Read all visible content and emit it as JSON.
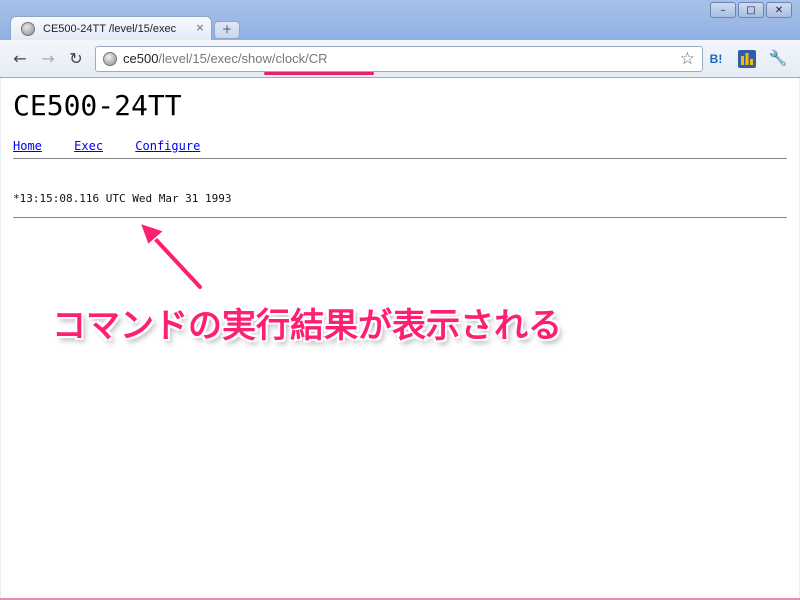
{
  "browser": {
    "tab_title": "CE500-24TT /level/15/exec",
    "tab_close": "×",
    "new_tab": "+",
    "window_buttons": {
      "minimize": "–",
      "maximize": "□",
      "close": "✕"
    },
    "back": "←",
    "forward": "→",
    "reload": "↻",
    "url_host": "ce500",
    "url_path": "/level/15/exec/show/clock/CR",
    "bookmark_star": "☆",
    "hatena_label": "B!",
    "wrench": "🔧"
  },
  "page": {
    "title": "CE500-24TT",
    "nav": [
      {
        "label": "Home"
      },
      {
        "label": "Exec"
      },
      {
        "label": "Configure"
      }
    ],
    "command_output": "*13:15:08.116 UTC Wed Mar 31 1993"
  },
  "annotation": {
    "text": "コマンドの実行結果が表示される",
    "color": "#ff1f72"
  },
  "colors": {
    "accent": "#e81f6f",
    "link": "#0000ee",
    "chrome_frame": "#8fb0e3"
  }
}
